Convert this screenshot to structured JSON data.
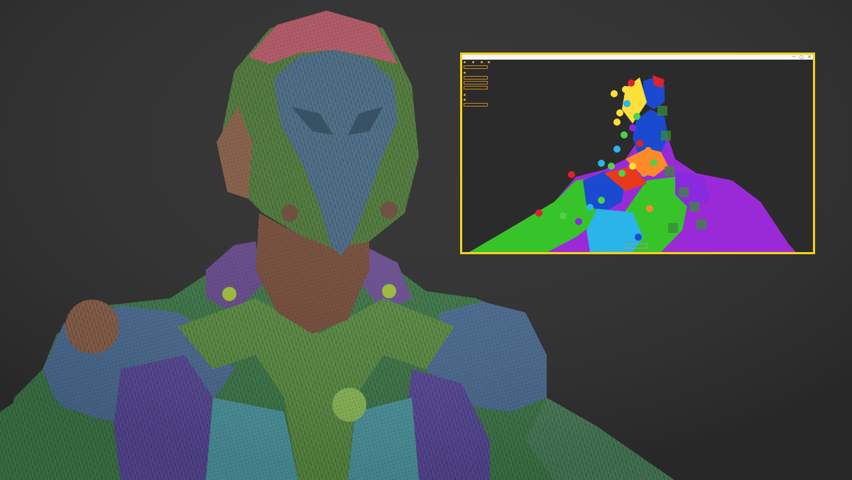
{
  "scene": {
    "background_color": "#2e2e2e",
    "main_subject": "polygroup-mesh-bust",
    "polygroup_colors": [
      "#c45a6a",
      "#5b86a8",
      "#4f8a3f",
      "#7a5a9c",
      "#8a6048",
      "#9fbf3a",
      "#4fa0a8",
      "#3f5fa8",
      "#6aa84f"
    ]
  },
  "inset": {
    "border_color": "#f4d21a",
    "titlebar_controls": [
      "─",
      "□",
      "✕"
    ],
    "panel": {
      "rows": [
        {
          "type": "icons",
          "text": ""
        },
        {
          "type": "button",
          "text": ""
        },
        {
          "type": "radio",
          "text": ""
        },
        {
          "type": "button",
          "text": ""
        },
        {
          "type": "button",
          "text": ""
        },
        {
          "type": "button",
          "text": ""
        },
        {
          "type": "radio",
          "text": ""
        },
        {
          "type": "radio",
          "text": ""
        },
        {
          "type": "button",
          "text": ""
        }
      ]
    },
    "footer_button": "",
    "marker_colors": [
      "#e0202a",
      "#ffe03a",
      "#4fd24a",
      "#2ab4e8",
      "#8a2ae0",
      "#ff8a2a",
      "#1a4ad0"
    ]
  }
}
